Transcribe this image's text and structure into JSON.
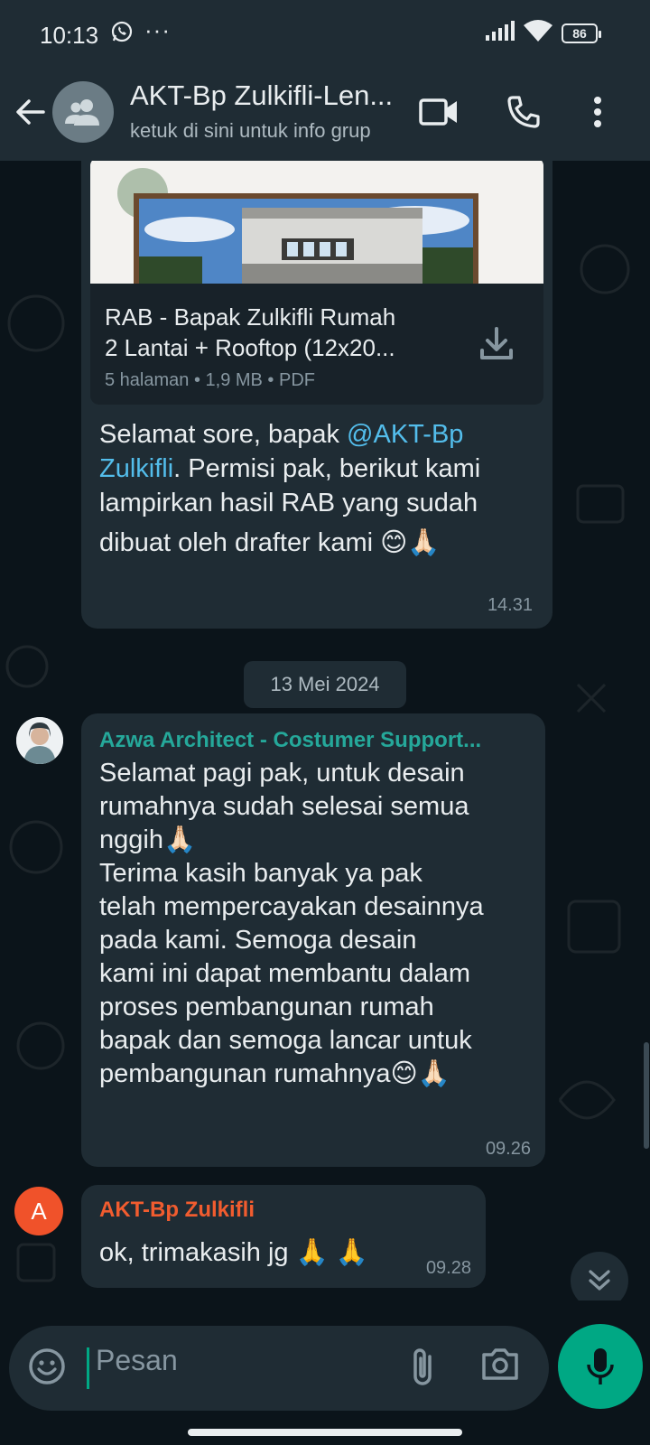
{
  "status_bar": {
    "time": "10:13",
    "battery": "86"
  },
  "header": {
    "title": "AKT-Bp Zulkifli-Len...",
    "subtitle": "ketuk di sini untuk info grup"
  },
  "messages": {
    "document": {
      "name_line1": "RAB - Bapak Zulkifli Rumah",
      "name_line2": "2 Lantai + Rooftop (12x20...",
      "meta": "5 halaman • 1,9 MB • PDF",
      "caption_line1_a": "Selamat sore, bapak ",
      "caption_mention_1": "@AKT-Bp",
      "caption_mention_2": "Zulkifli",
      "caption_line2_b": ". Permisi pak, berikut kami",
      "caption_line3": "lampirkan hasil RAB yang sudah",
      "caption_line4": "dibuat oleh drafter kami 😊🙏🏻",
      "time": "14.31"
    },
    "date_divider": "13 Mei 2024",
    "support": {
      "sender": "Azwa Architect - Costumer Support...",
      "sender_color": "#25a89a",
      "lines": [
        "Selamat pagi pak, untuk desain",
        "rumahnya sudah selesai semua",
        "nggih🙏🏻",
        "Terima kasih banyak ya pak",
        "telah mempercayakan desainnya",
        "pada kami. Semoga desain",
        "kami ini dapat membantu dalam",
        "proses pembangunan rumah",
        "bapak dan semoga lancar untuk",
        "pembangunan rumahnya😊🙏🏻"
      ],
      "time": "09.26"
    },
    "reply": {
      "avatar_letter": "A",
      "sender": "AKT-Bp Zulkifli",
      "sender_color": "#f15c2f",
      "text": "ok, trimakasih jg 🙏 🙏",
      "time": "09.28"
    }
  },
  "composer": {
    "placeholder": "Pesan"
  },
  "icons": {
    "back": "arrow-left-icon",
    "group": "group-icon",
    "video": "video-call-icon",
    "call": "phone-icon",
    "menu": "more-vert-icon",
    "download": "download-icon",
    "emoji": "emoji-icon",
    "attach": "paperclip-icon",
    "camera": "camera-icon",
    "mic": "mic-icon",
    "scroll": "double-chevron-down-icon"
  },
  "colors": {
    "accent": "#00a884",
    "mention": "#53bdeb",
    "bubble": "#1f2c34",
    "background": "#0b141a"
  }
}
